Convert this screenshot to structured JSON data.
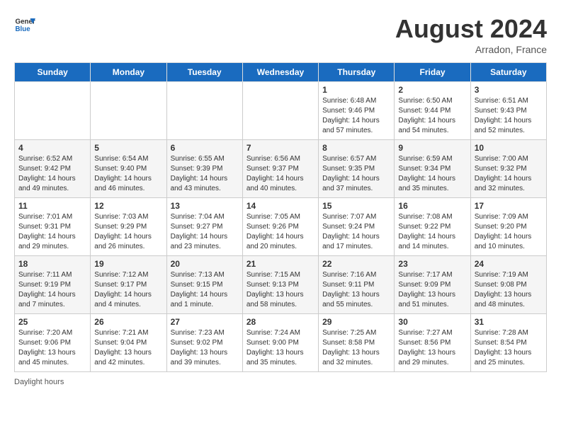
{
  "header": {
    "logo_line1": "General",
    "logo_line2": "Blue",
    "month_title": "August 2024",
    "location": "Arradon, France"
  },
  "footer": {
    "daylight_label": "Daylight hours"
  },
  "weekdays": [
    "Sunday",
    "Monday",
    "Tuesday",
    "Wednesday",
    "Thursday",
    "Friday",
    "Saturday"
  ],
  "weeks": [
    [
      {
        "day": "",
        "info": ""
      },
      {
        "day": "",
        "info": ""
      },
      {
        "day": "",
        "info": ""
      },
      {
        "day": "",
        "info": ""
      },
      {
        "day": "1",
        "info": "Sunrise: 6:48 AM\nSunset: 9:46 PM\nDaylight: 14 hours and 57 minutes."
      },
      {
        "day": "2",
        "info": "Sunrise: 6:50 AM\nSunset: 9:44 PM\nDaylight: 14 hours and 54 minutes."
      },
      {
        "day": "3",
        "info": "Sunrise: 6:51 AM\nSunset: 9:43 PM\nDaylight: 14 hours and 52 minutes."
      }
    ],
    [
      {
        "day": "4",
        "info": "Sunrise: 6:52 AM\nSunset: 9:42 PM\nDaylight: 14 hours and 49 minutes."
      },
      {
        "day": "5",
        "info": "Sunrise: 6:54 AM\nSunset: 9:40 PM\nDaylight: 14 hours and 46 minutes."
      },
      {
        "day": "6",
        "info": "Sunrise: 6:55 AM\nSunset: 9:39 PM\nDaylight: 14 hours and 43 minutes."
      },
      {
        "day": "7",
        "info": "Sunrise: 6:56 AM\nSunset: 9:37 PM\nDaylight: 14 hours and 40 minutes."
      },
      {
        "day": "8",
        "info": "Sunrise: 6:57 AM\nSunset: 9:35 PM\nDaylight: 14 hours and 37 minutes."
      },
      {
        "day": "9",
        "info": "Sunrise: 6:59 AM\nSunset: 9:34 PM\nDaylight: 14 hours and 35 minutes."
      },
      {
        "day": "10",
        "info": "Sunrise: 7:00 AM\nSunset: 9:32 PM\nDaylight: 14 hours and 32 minutes."
      }
    ],
    [
      {
        "day": "11",
        "info": "Sunrise: 7:01 AM\nSunset: 9:31 PM\nDaylight: 14 hours and 29 minutes."
      },
      {
        "day": "12",
        "info": "Sunrise: 7:03 AM\nSunset: 9:29 PM\nDaylight: 14 hours and 26 minutes."
      },
      {
        "day": "13",
        "info": "Sunrise: 7:04 AM\nSunset: 9:27 PM\nDaylight: 14 hours and 23 minutes."
      },
      {
        "day": "14",
        "info": "Sunrise: 7:05 AM\nSunset: 9:26 PM\nDaylight: 14 hours and 20 minutes."
      },
      {
        "day": "15",
        "info": "Sunrise: 7:07 AM\nSunset: 9:24 PM\nDaylight: 14 hours and 17 minutes."
      },
      {
        "day": "16",
        "info": "Sunrise: 7:08 AM\nSunset: 9:22 PM\nDaylight: 14 hours and 14 minutes."
      },
      {
        "day": "17",
        "info": "Sunrise: 7:09 AM\nSunset: 9:20 PM\nDaylight: 14 hours and 10 minutes."
      }
    ],
    [
      {
        "day": "18",
        "info": "Sunrise: 7:11 AM\nSunset: 9:19 PM\nDaylight: 14 hours and 7 minutes."
      },
      {
        "day": "19",
        "info": "Sunrise: 7:12 AM\nSunset: 9:17 PM\nDaylight: 14 hours and 4 minutes."
      },
      {
        "day": "20",
        "info": "Sunrise: 7:13 AM\nSunset: 9:15 PM\nDaylight: 14 hours and 1 minute."
      },
      {
        "day": "21",
        "info": "Sunrise: 7:15 AM\nSunset: 9:13 PM\nDaylight: 13 hours and 58 minutes."
      },
      {
        "day": "22",
        "info": "Sunrise: 7:16 AM\nSunset: 9:11 PM\nDaylight: 13 hours and 55 minutes."
      },
      {
        "day": "23",
        "info": "Sunrise: 7:17 AM\nSunset: 9:09 PM\nDaylight: 13 hours and 51 minutes."
      },
      {
        "day": "24",
        "info": "Sunrise: 7:19 AM\nSunset: 9:08 PM\nDaylight: 13 hours and 48 minutes."
      }
    ],
    [
      {
        "day": "25",
        "info": "Sunrise: 7:20 AM\nSunset: 9:06 PM\nDaylight: 13 hours and 45 minutes."
      },
      {
        "day": "26",
        "info": "Sunrise: 7:21 AM\nSunset: 9:04 PM\nDaylight: 13 hours and 42 minutes."
      },
      {
        "day": "27",
        "info": "Sunrise: 7:23 AM\nSunset: 9:02 PM\nDaylight: 13 hours and 39 minutes."
      },
      {
        "day": "28",
        "info": "Sunrise: 7:24 AM\nSunset: 9:00 PM\nDaylight: 13 hours and 35 minutes."
      },
      {
        "day": "29",
        "info": "Sunrise: 7:25 AM\nSunset: 8:58 PM\nDaylight: 13 hours and 32 minutes."
      },
      {
        "day": "30",
        "info": "Sunrise: 7:27 AM\nSunset: 8:56 PM\nDaylight: 13 hours and 29 minutes."
      },
      {
        "day": "31",
        "info": "Sunrise: 7:28 AM\nSunset: 8:54 PM\nDaylight: 13 hours and 25 minutes."
      }
    ]
  ]
}
